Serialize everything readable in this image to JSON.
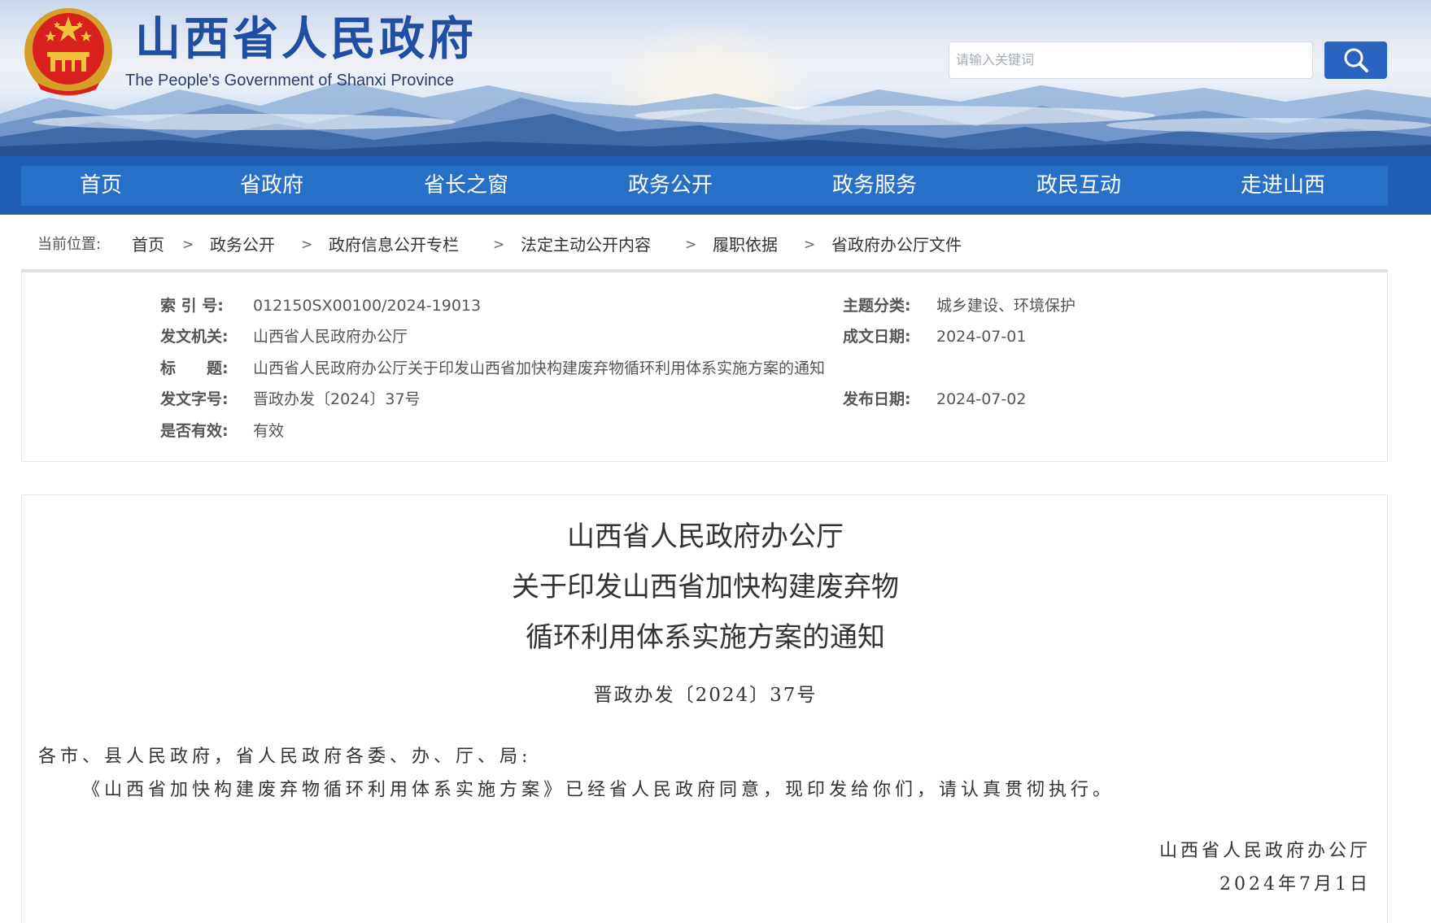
{
  "header": {
    "title": "山西省人民政府",
    "subtitle": "The People's Government of Shanxi Province",
    "search_placeholder": "请输入关键词"
  },
  "nav": {
    "items": [
      "首页",
      "省政府",
      "省长之窗",
      "政务公开",
      "政务服务",
      "政民互动",
      "走进山西"
    ]
  },
  "breadcrumb": {
    "label": "当前位置:",
    "items": [
      "首页",
      "政务公开",
      "政府信息公开专栏",
      "法定主动公开内容",
      "履职依据",
      "省政府办公厅文件"
    ],
    "separator": ">"
  },
  "meta": {
    "index_label": "索 引 号:",
    "index_value": "012150SX00100/2024-19013",
    "topic_label": "主题分类:",
    "topic_value": "城乡建设、环境保护",
    "issuer_label": "发文机关:",
    "issuer_value": "山西省人民政府办公厅",
    "date_label": "成文日期:",
    "date_value": "2024-07-01",
    "title_label": "标　　题:",
    "title_value": "山西省人民政府办公厅关于印发山西省加快构建废弃物循环利用体系实施方案的通知",
    "docno_label": "发文字号:",
    "docno_value": "晋政办发〔2024〕37号",
    "pubdate_label": "发布日期:",
    "pubdate_value": "2024-07-02",
    "valid_label": "是否有效:",
    "valid_value": "有效"
  },
  "article": {
    "title_line1": "山西省人民政府办公厅",
    "title_line2": "关于印发山西省加快构建废弃物",
    "title_line3": "循环利用体系实施方案的通知",
    "doc_number": "晋政办发〔2024〕37号",
    "salutation": "各市、县人民政府，省人民政府各委、办、厅、局:",
    "paragraph1": "《山西省加快构建废弃物循环利用体系实施方案》已经省人民政府同意，现印发给你们，请认真贯彻执行。",
    "signature": "山西省人民政府办公厅",
    "sign_date": "2024年7月1日"
  },
  "colors": {
    "nav_bg": "#1d5fb5",
    "nav_inner": "#2670c8",
    "title_blue": "#1f4ea3",
    "search_button": "#2b64c0"
  }
}
